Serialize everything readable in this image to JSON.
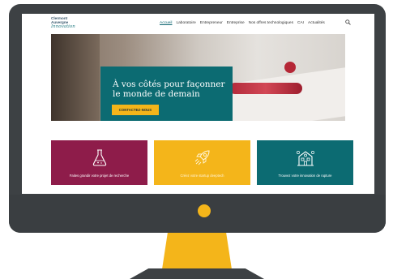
{
  "logo": {
    "line1": "Clermont",
    "line2": "Auvergne",
    "line3": "Innovation"
  },
  "nav": {
    "items": [
      {
        "label": "Accueil"
      },
      {
        "label": "Laboratoire"
      },
      {
        "label": "Entrepreneur"
      },
      {
        "label": "Entreprise"
      },
      {
        "label": "Nos offres technologiques"
      },
      {
        "label": "CAI"
      },
      {
        "label": "Actualités"
      }
    ],
    "search_icon": "search-icon"
  },
  "hero": {
    "title": "À vos côtés pour façonner le monde de demain",
    "button_label": "CONTACTEZ-NOUS"
  },
  "cards": [
    {
      "icon": "flask-icon",
      "label": "Faites grandir votre projet de recherche"
    },
    {
      "icon": "rocket-icon",
      "label": "Créez votre startup deeptech"
    },
    {
      "icon": "building-icon",
      "label": "Trouvez votre innovation de rupture"
    }
  ],
  "colors": {
    "teal": "#0c6b72",
    "yellow": "#f4b51a",
    "burgundy": "#8e1c4a",
    "monitor": "#3d4144"
  }
}
